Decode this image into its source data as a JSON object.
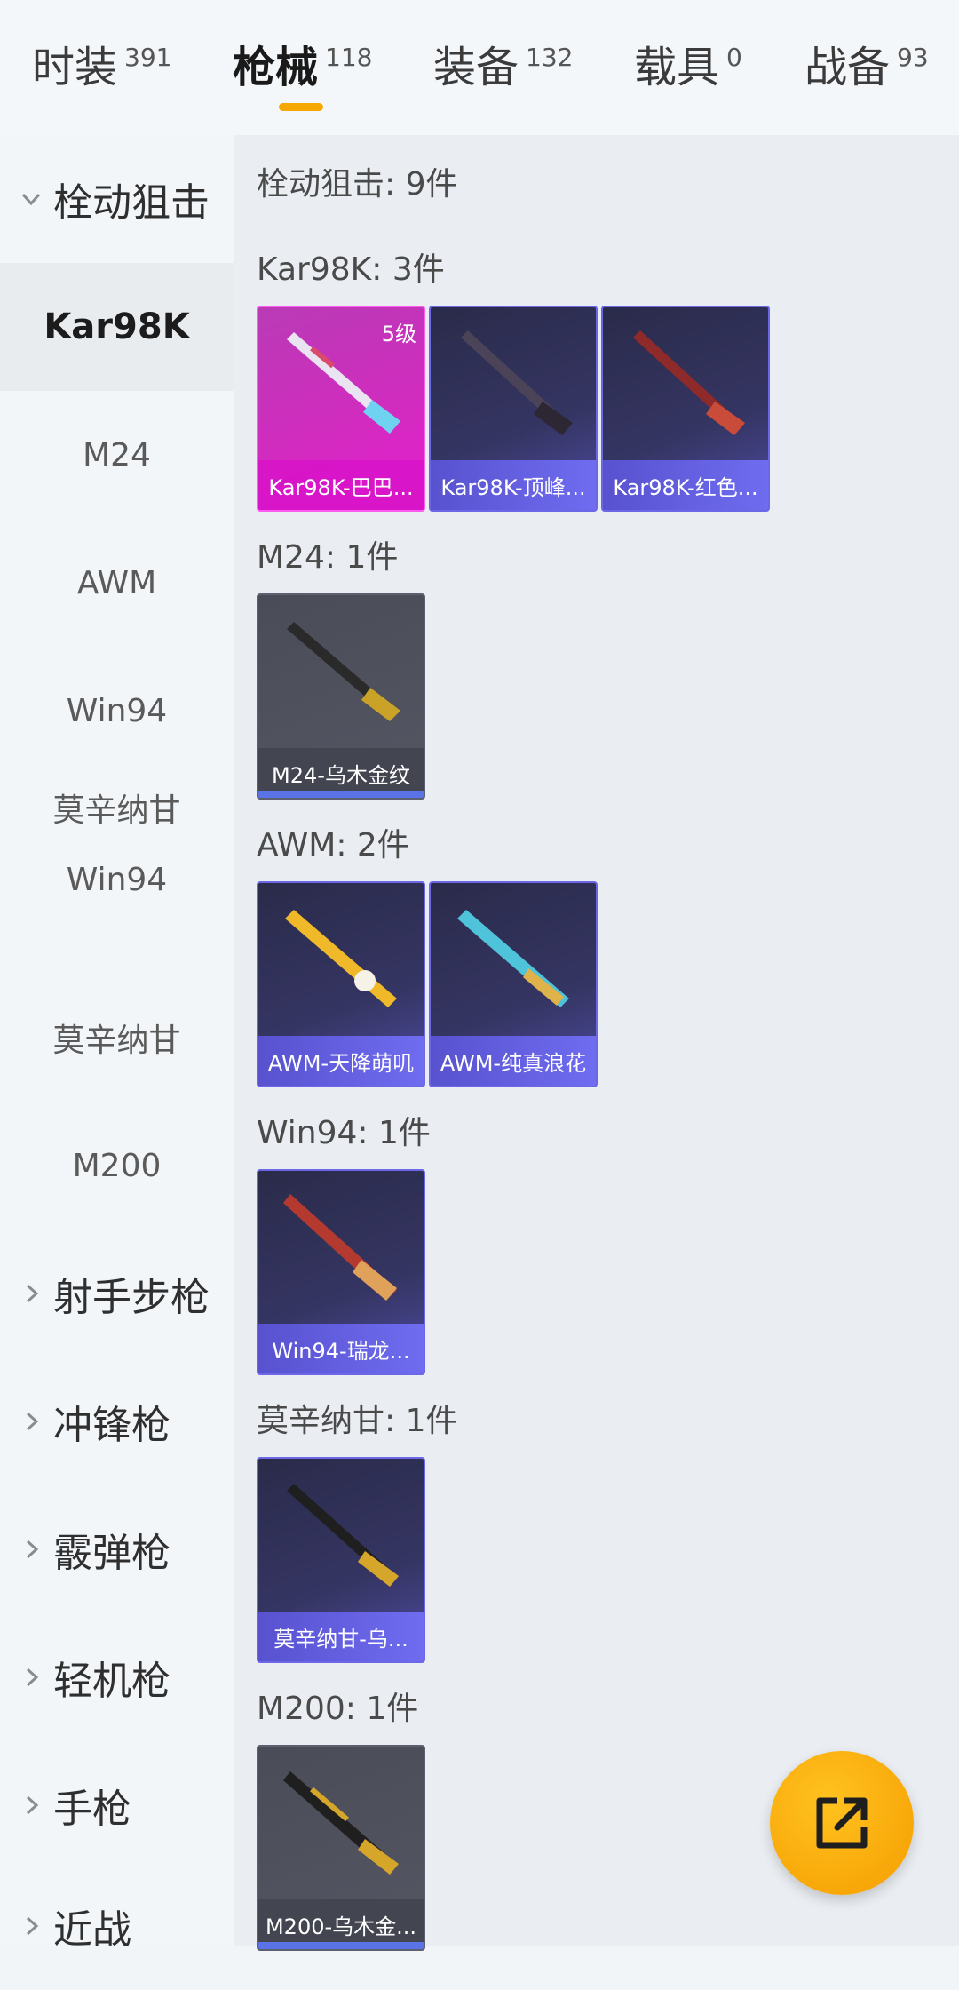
{
  "tabs": [
    {
      "label": "时装",
      "count": "391"
    },
    {
      "label": "枪械",
      "count": "118"
    },
    {
      "label": "装备",
      "count": "132"
    },
    {
      "label": "载具",
      "count": "0"
    },
    {
      "label": "战备",
      "count": "93"
    }
  ],
  "sidebar": {
    "group_open": "栓动狙击",
    "items": [
      "Kar98K",
      "M24",
      "AWM",
      "Win94",
      "莫辛纳甘",
      "Win94",
      "莫辛纳甘",
      "M200"
    ],
    "groups": [
      "射手步枪",
      "冲锋枪",
      "霰弹枪",
      "轻机枪",
      "手枪",
      "近战"
    ]
  },
  "content": {
    "summary": "栓动狙击: 9件",
    "sections": [
      {
        "title": "Kar98K: 3件",
        "cards": [
          {
            "name": "Kar98K-巴巴...",
            "level": "5级"
          },
          {
            "name": "Kar98K-顶峰..."
          },
          {
            "name": "Kar98K-红色..."
          }
        ]
      },
      {
        "title": "M24: 1件",
        "cards": [
          {
            "name": "M24-乌木金纹"
          }
        ]
      },
      {
        "title": "AWM: 2件",
        "cards": [
          {
            "name": "AWM-天降萌叽"
          },
          {
            "name": "AWM-纯真浪花"
          }
        ]
      },
      {
        "title": "Win94: 1件",
        "cards": [
          {
            "name": "Win94-瑞龙..."
          }
        ]
      },
      {
        "title": "莫辛纳甘: 1件",
        "cards": [
          {
            "name": "莫辛纳甘-乌..."
          }
        ]
      },
      {
        "title": "M200: 1件",
        "cards": [
          {
            "name": "M200-乌木金..."
          }
        ]
      }
    ]
  },
  "icons": {
    "chevron_down": "chevron-down-icon",
    "chevron_right": "chevron-right-icon",
    "share": "share-icon"
  },
  "colors": {
    "accent": "#f7a800",
    "rarity_pink": "#e81dd0",
    "rarity_purple": "#6b67e6",
    "rarity_gray": "#545663"
  }
}
